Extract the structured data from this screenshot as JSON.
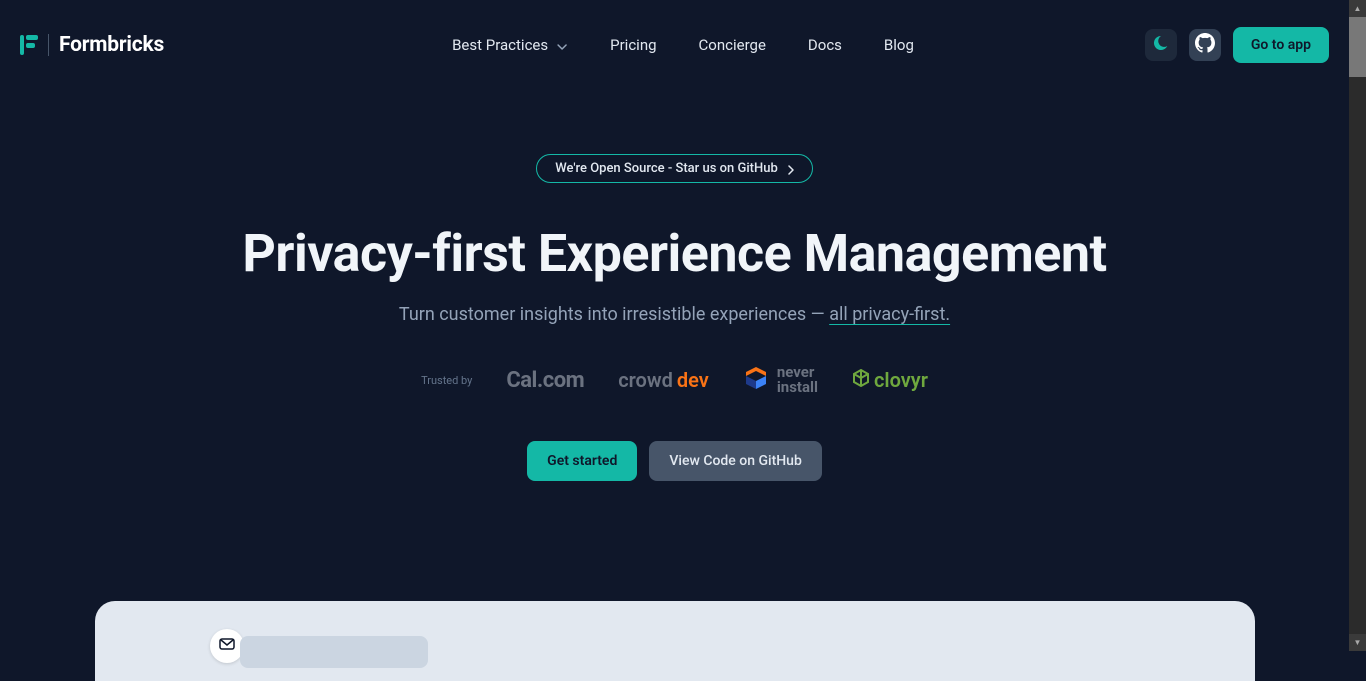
{
  "brand": {
    "name": "Formbricks"
  },
  "nav": {
    "items": {
      "best_practices": "Best Practices",
      "pricing": "Pricing",
      "concierge": "Concierge",
      "docs": "Docs",
      "blog": "Blog"
    },
    "cta": "Go to app"
  },
  "hero": {
    "pill": "We're Open Source - Star us on GitHub",
    "headline": "Privacy-first Experience Management",
    "sub_prefix": "Turn customer insights into irresistible experiences — ",
    "sub_link": "all privacy-first.",
    "trusted_label": "Trusted by",
    "logos": {
      "cal": "Cal.com",
      "crowd_a": "crowd",
      "crowd_b": "dev",
      "never_a": "never",
      "never_b": "install",
      "clovyr": "clovyr"
    },
    "btn_primary": "Get started",
    "btn_secondary": "View Code on GitHub"
  }
}
